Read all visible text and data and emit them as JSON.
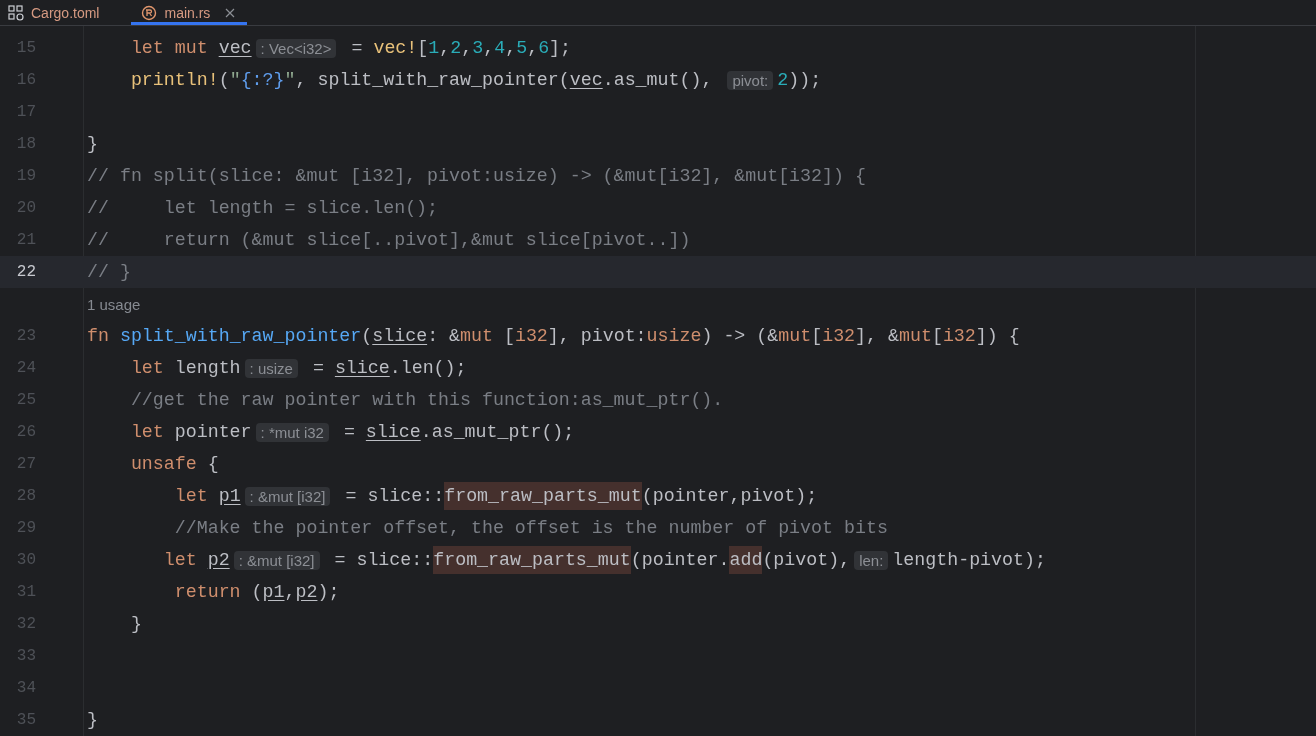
{
  "tabs": [
    {
      "label": "Cargo.toml",
      "selected": false,
      "closable": false
    },
    {
      "label": "main.rs",
      "selected": true,
      "closable": true
    }
  ],
  "lines": [
    {
      "kind": "code",
      "number": "15",
      "current": false,
      "tokens": [
        {
          "kind": "kw",
          "text": "    let mut "
        },
        {
          "kind": "var",
          "text": "vec"
        },
        {
          "kind": "hint",
          "text": ": Vec<i32>"
        },
        {
          "kind": "plain",
          "text": " = "
        },
        {
          "kind": "macro",
          "text": "vec!"
        },
        {
          "kind": "plain",
          "text": "["
        },
        {
          "kind": "num",
          "text": "1"
        },
        {
          "kind": "plain",
          "text": ","
        },
        {
          "kind": "num",
          "text": "2"
        },
        {
          "kind": "plain",
          "text": ","
        },
        {
          "kind": "num",
          "text": "3"
        },
        {
          "kind": "plain",
          "text": ","
        },
        {
          "kind": "num",
          "text": "4"
        },
        {
          "kind": "plain",
          "text": ","
        },
        {
          "kind": "num",
          "text": "5"
        },
        {
          "kind": "plain",
          "text": ","
        },
        {
          "kind": "num",
          "text": "6"
        },
        {
          "kind": "plain",
          "text": "];"
        }
      ]
    },
    {
      "kind": "code",
      "number": "16",
      "current": false,
      "tokens": [
        {
          "kind": "macro",
          "text": "    println!"
        },
        {
          "kind": "plain",
          "text": "("
        },
        {
          "kind": "str",
          "text": "\""
        },
        {
          "kind": "fmt",
          "text": "{:?}"
        },
        {
          "kind": "str",
          "text": "\""
        },
        {
          "kind": "plain",
          "text": ", split_with_raw_pointer("
        },
        {
          "kind": "var",
          "text": "vec"
        },
        {
          "kind": "plain",
          "text": ".as_mut(), "
        },
        {
          "kind": "hint",
          "text": "pivot:"
        },
        {
          "kind": "num",
          "text": "2"
        },
        {
          "kind": "plain",
          "text": "));"
        }
      ]
    },
    {
      "kind": "code",
      "number": "17",
      "current": false
    },
    {
      "kind": "code",
      "number": "18",
      "current": false,
      "tokens": [
        {
          "kind": "plain",
          "text": "}"
        }
      ]
    },
    {
      "kind": "code",
      "number": "19",
      "current": false,
      "tokens": [
        {
          "kind": "comment",
          "text": "// fn split(slice: &mut [i32], pivot:usize) -> (&mut[i32], &mut[i32]) {"
        }
      ]
    },
    {
      "kind": "code",
      "number": "20",
      "current": false,
      "tokens": [
        {
          "kind": "comment",
          "text": "//     let length = slice.len();"
        }
      ]
    },
    {
      "kind": "code",
      "number": "21",
      "current": false,
      "tokens": [
        {
          "kind": "comment",
          "text": "//     return (&mut slice[..pivot],&mut slice[pivot..])"
        }
      ]
    },
    {
      "kind": "code",
      "number": "22",
      "current": true,
      "tokens": [
        {
          "kind": "comment",
          "text": "// }"
        }
      ]
    },
    {
      "kind": "usage",
      "text": "1 usage"
    },
    {
      "kind": "code",
      "number": "23",
      "current": false,
      "tokens": [
        {
          "kind": "kw",
          "text": "fn "
        },
        {
          "kind": "fn",
          "text": "split_with_raw_pointer"
        },
        {
          "kind": "plain",
          "text": "("
        },
        {
          "kind": "var",
          "text": "slice"
        },
        {
          "kind": "plain",
          "text": ": &"
        },
        {
          "kind": "kw",
          "text": "mut"
        },
        {
          "kind": "plain",
          "text": " ["
        },
        {
          "kind": "kw",
          "text": "i32"
        },
        {
          "kind": "plain",
          "text": "], pivot:"
        },
        {
          "kind": "kw",
          "text": "usize"
        },
        {
          "kind": "plain",
          "text": ") -> (&"
        },
        {
          "kind": "kw",
          "text": "mut"
        },
        {
          "kind": "plain",
          "text": "["
        },
        {
          "kind": "kw",
          "text": "i32"
        },
        {
          "kind": "plain",
          "text": "], &"
        },
        {
          "kind": "kw",
          "text": "mut"
        },
        {
          "kind": "plain",
          "text": "["
        },
        {
          "kind": "kw",
          "text": "i32"
        },
        {
          "kind": "plain",
          "text": "]) {"
        }
      ]
    },
    {
      "kind": "code",
      "number": "24",
      "current": false,
      "tokens": [
        {
          "kind": "kw",
          "text": "    let "
        },
        {
          "kind": "plain",
          "text": "length"
        },
        {
          "kind": "hint",
          "text": ": usize"
        },
        {
          "kind": "plain",
          "text": " = "
        },
        {
          "kind": "var",
          "text": "slice"
        },
        {
          "kind": "plain",
          "text": ".len();"
        }
      ]
    },
    {
      "kind": "code",
      "number": "25",
      "current": false,
      "tokens": [
        {
          "kind": "comment",
          "text": "    //get the raw pointer with this function:as_mut_ptr()."
        }
      ]
    },
    {
      "kind": "code",
      "number": "26",
      "current": false,
      "tokens": [
        {
          "kind": "kw",
          "text": "    let "
        },
        {
          "kind": "plain",
          "text": "pointer"
        },
        {
          "kind": "hint",
          "text": ": *mut i32"
        },
        {
          "kind": "plain",
          "text": " = "
        },
        {
          "kind": "var",
          "text": "slice"
        },
        {
          "kind": "plain",
          "text": ".as_mut_ptr();"
        }
      ]
    },
    {
      "kind": "code",
      "number": "27",
      "current": false,
      "tokens": [
        {
          "kind": "kw",
          "text": "    unsafe"
        },
        {
          "kind": "plain",
          "text": " {"
        }
      ]
    },
    {
      "kind": "code",
      "number": "28",
      "current": false,
      "tokens": [
        {
          "kind": "kw",
          "text": "        let "
        },
        {
          "kind": "var",
          "text": "p1"
        },
        {
          "kind": "hint",
          "text": ": &mut [i32]"
        },
        {
          "kind": "plain",
          "text": " = slice::"
        },
        {
          "kind": "unsafe",
          "text": "from_raw_parts_mut"
        },
        {
          "kind": "plain",
          "text": "(pointer,pivot);"
        }
      ]
    },
    {
      "kind": "code",
      "number": "29",
      "current": false,
      "tokens": [
        {
          "kind": "comment",
          "text": "        //Make the pointer offset, the offset is the number of pivot bits"
        }
      ]
    },
    {
      "kind": "code",
      "number": "30",
      "current": false,
      "tokens": [
        {
          "kind": "kw",
          "text": "       let "
        },
        {
          "kind": "var",
          "text": "p2"
        },
        {
          "kind": "hint",
          "text": ": &mut [i32]"
        },
        {
          "kind": "plain",
          "text": " = slice::"
        },
        {
          "kind": "unsafe",
          "text": "from_raw_parts_mut"
        },
        {
          "kind": "plain",
          "text": "(pointer."
        },
        {
          "kind": "unsafe",
          "text": "add"
        },
        {
          "kind": "plain",
          "text": "(pivot),"
        },
        {
          "kind": "hint",
          "text": "len:"
        },
        {
          "kind": "plain",
          "text": "length-pivot);"
        }
      ]
    },
    {
      "kind": "code",
      "number": "31",
      "current": false,
      "tokens": [
        {
          "kind": "kw",
          "text": "        return"
        },
        {
          "kind": "plain",
          "text": " ("
        },
        {
          "kind": "var",
          "text": "p1"
        },
        {
          "kind": "plain",
          "text": ","
        },
        {
          "kind": "var",
          "text": "p2"
        },
        {
          "kind": "plain",
          "text": ");"
        }
      ]
    },
    {
      "kind": "code",
      "number": "32",
      "current": false,
      "tokens": [
        {
          "kind": "plain",
          "text": "    }"
        }
      ]
    },
    {
      "kind": "code",
      "number": "33",
      "current": false
    },
    {
      "kind": "code",
      "number": "34",
      "current": false
    },
    {
      "kind": "code",
      "number": "35",
      "current": false,
      "tokens": [
        {
          "kind": "plain",
          "text": "}"
        }
      ]
    }
  ]
}
